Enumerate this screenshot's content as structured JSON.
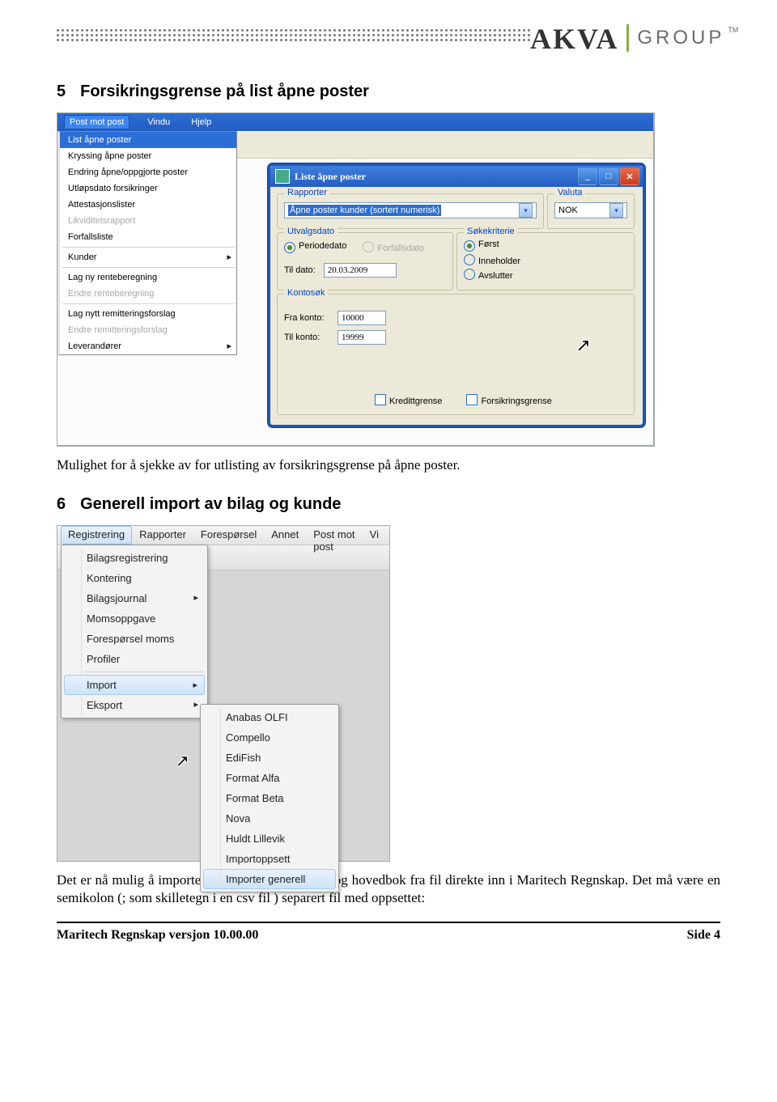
{
  "brand": {
    "part1": "AKVA",
    "part2": "GROUP",
    "tm": "TM"
  },
  "sec5": {
    "num": "5",
    "title": "Forsikringsgrense på list åpne poster",
    "para": "Mulighet for å sjekke av for utlisting av forsikringsgrense på åpne poster."
  },
  "sec6": {
    "num": "6",
    "title": "Generell import  av bilag og kunde",
    "para": "Det er nå mulig å importere kunder, leverandører og hovedbok fra fil direkte inn i Maritech Regnskap. Det må være en semikolon (; som skilletegn i en csv fil ) separert fil med oppsettet:"
  },
  "footer": {
    "left": "Maritech Regnskap versjon 10.00.00",
    "right": "Side 4"
  },
  "shot1": {
    "menubar": {
      "active": "Post mot post",
      "m1": "Vindu",
      "m2": "Hjelp"
    },
    "dropdown": [
      {
        "label": "List åpne poster",
        "sel": true
      },
      {
        "label": "Kryssing åpne poster"
      },
      {
        "label": "Endring åpne/oppgjorte poster"
      },
      {
        "label": "Utløpsdato forsikringer"
      },
      {
        "label": "Attestasjonslister"
      },
      {
        "label": "Likviditetsrapport",
        "dis": true
      },
      {
        "label": "Forfallsliste"
      },
      {
        "sep": true
      },
      {
        "label": "Kunder",
        "arrow": true
      },
      {
        "sep": true
      },
      {
        "label": "Lag ny renteberegning"
      },
      {
        "label": "Endre renteberegning",
        "dis": true
      },
      {
        "sep": true
      },
      {
        "label": "Lag nytt remitteringsforslag"
      },
      {
        "label": "Endre remitteringsforslag",
        "dis": true
      },
      {
        "label": "Leverandører",
        "arrow": true
      }
    ],
    "dlg": {
      "title": "Liste åpne poster",
      "rapporter": {
        "legend": "Rapporter",
        "value": "Åpne poster kunder (sortert numerisk)"
      },
      "valuta": {
        "legend": "Valuta",
        "value": "NOK"
      },
      "utvalg": {
        "legend": "Utvalgsdato",
        "r1": "Periodedato",
        "r2": "Forfallsdato",
        "tildato_label": "Til dato:",
        "tildato_value": "20.03.2009"
      },
      "sokekriterie": {
        "legend": "Søkekriterie",
        "r1": "Først",
        "r2": "Inneholder",
        "r3": "Avslutter"
      },
      "kontosok": {
        "legend": "Kontosøk",
        "fra_label": "Fra konto:",
        "fra_value": "10000",
        "til_label": "Til konto:",
        "til_value": "19999",
        "cb1": "Kredittgrense",
        "cb2": "Forsikringsgrense"
      }
    }
  },
  "shot2": {
    "menubar": {
      "m0": "Registrering",
      "m1": "Rapporter",
      "m2": "Forespørsel",
      "m3": "Annet",
      "m4": "Post mot post",
      "m5": "Vi"
    },
    "menu1": [
      {
        "label": "Bilagsregistrering"
      },
      {
        "label": "Kontering"
      },
      {
        "label": "Bilagsjournal",
        "arrow": true
      },
      {
        "label": "Momsoppgave"
      },
      {
        "label": "Forespørsel moms"
      },
      {
        "label": "Profiler"
      },
      {
        "sep": true
      },
      {
        "label": "Import",
        "arrow": true,
        "hover": true
      },
      {
        "label": "Eksport",
        "arrow": true
      }
    ],
    "menu2": [
      {
        "label": "Anabas OLFI"
      },
      {
        "label": "Compello"
      },
      {
        "label": "EdiFish"
      },
      {
        "label": "Format Alfa"
      },
      {
        "label": "Format Beta"
      },
      {
        "label": "Nova"
      },
      {
        "label": "Huldt Lillevik"
      },
      {
        "label": "Importoppsett"
      },
      {
        "label": "Importer generell",
        "hover": true
      }
    ]
  }
}
